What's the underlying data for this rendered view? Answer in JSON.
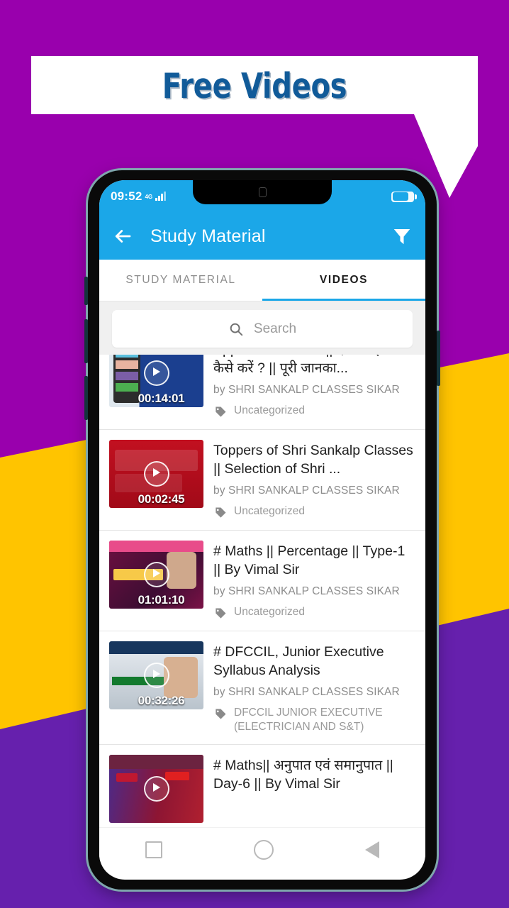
{
  "promo": {
    "headline": "Free Videos"
  },
  "phone": {
    "status": {
      "time": "09:52",
      "network": "4G",
      "signal_icon": "signal-bars-icon",
      "battery_icon": "battery-icon"
    },
    "appbar": {
      "back_icon": "back-arrow-icon",
      "title": "Study Material",
      "filter_icon": "filter-funnel-icon"
    },
    "tabs": [
      {
        "label": "STUDY MATERIAL",
        "active": false
      },
      {
        "label": "VIDEOS",
        "active": true
      }
    ],
    "search": {
      "icon": "search-icon",
      "placeholder": "Search",
      "value": ""
    },
    "videos": [
      {
        "title": "Application Demo || ऐप का इस्तमाल कैसे करें ? || पूरी जानका...",
        "author": "by SHRI SANKALP CLASSES SIKAR",
        "category": "Uncategorized",
        "duration": "00:14:01",
        "tag_icon": "tag-icon",
        "play_icon": "play-icon"
      },
      {
        "title": "Toppers of Shri Sankalp Classes || Selection of Shri ...",
        "author": "by SHRI SANKALP CLASSES SIKAR",
        "category": "Uncategorized",
        "duration": "00:02:45",
        "tag_icon": "tag-icon",
        "play_icon": "play-icon"
      },
      {
        "title": "# Maths || Percentage || Type-1  || By Vimal Sir",
        "author": "by SHRI SANKALP CLASSES SIKAR",
        "category": "Uncategorized",
        "duration": "01:01:10",
        "tag_icon": "tag-icon",
        "play_icon": "play-icon"
      },
      {
        "title": "# DFCCIL,  Junior Executive Syllabus Analysis",
        "author": "by SHRI SANKALP CLASSES SIKAR",
        "category": "DFCCIL JUNIOR EXECUTIVE (ELECTRICIAN AND S&T)",
        "duration": "00:32:26",
        "tag_icon": "tag-icon",
        "play_icon": "play-icon"
      },
      {
        "title": "# Maths|| अनुपात एवं समानुपात || Day-6 || By Vimal Sir",
        "author": "",
        "category": "",
        "duration": "",
        "tag_icon": "tag-icon",
        "play_icon": "play-icon"
      }
    ],
    "navbar": {
      "recents_icon": "square-recents-icon",
      "home_icon": "circle-home-icon",
      "back_icon": "triangle-back-icon"
    }
  },
  "colors": {
    "purple_top": "#9900ad",
    "purple_bottom": "#6620ad",
    "yellow": "#ffc400",
    "appbar_blue": "#1ba7e8",
    "headline_blue": "#115b99"
  }
}
